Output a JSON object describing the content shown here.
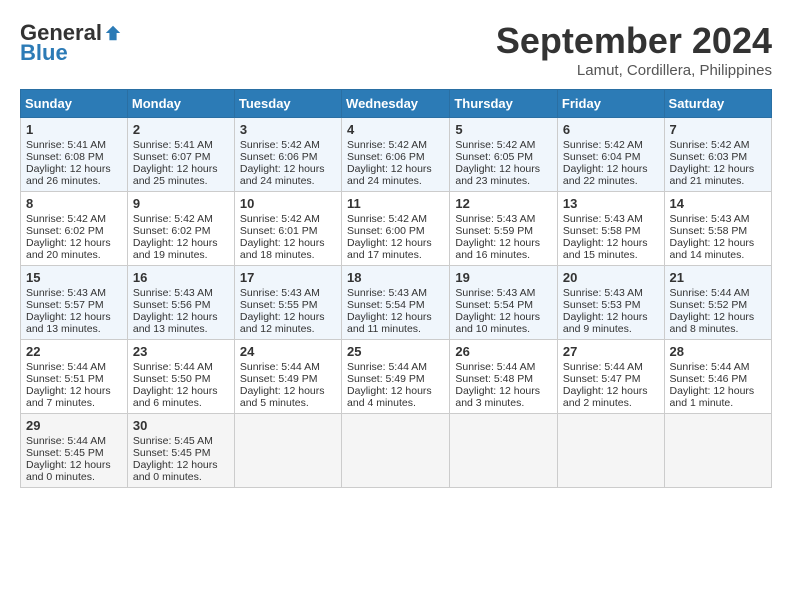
{
  "header": {
    "logo_general": "General",
    "logo_blue": "Blue",
    "month_title": "September 2024",
    "location": "Lamut, Cordillera, Philippines"
  },
  "calendar": {
    "days_of_week": [
      "Sunday",
      "Monday",
      "Tuesday",
      "Wednesday",
      "Thursday",
      "Friday",
      "Saturday"
    ],
    "weeks": [
      [
        {
          "day": "1",
          "sunrise": "Sunrise: 5:41 AM",
          "sunset": "Sunset: 6:08 PM",
          "daylight": "Daylight: 12 hours and 26 minutes."
        },
        {
          "day": "2",
          "sunrise": "Sunrise: 5:41 AM",
          "sunset": "Sunset: 6:07 PM",
          "daylight": "Daylight: 12 hours and 25 minutes."
        },
        {
          "day": "3",
          "sunrise": "Sunrise: 5:42 AM",
          "sunset": "Sunset: 6:06 PM",
          "daylight": "Daylight: 12 hours and 24 minutes."
        },
        {
          "day": "4",
          "sunrise": "Sunrise: 5:42 AM",
          "sunset": "Sunset: 6:06 PM",
          "daylight": "Daylight: 12 hours and 24 minutes."
        },
        {
          "day": "5",
          "sunrise": "Sunrise: 5:42 AM",
          "sunset": "Sunset: 6:05 PM",
          "daylight": "Daylight: 12 hours and 23 minutes."
        },
        {
          "day": "6",
          "sunrise": "Sunrise: 5:42 AM",
          "sunset": "Sunset: 6:04 PM",
          "daylight": "Daylight: 12 hours and 22 minutes."
        },
        {
          "day": "7",
          "sunrise": "Sunrise: 5:42 AM",
          "sunset": "Sunset: 6:03 PM",
          "daylight": "Daylight: 12 hours and 21 minutes."
        }
      ],
      [
        {
          "day": "8",
          "sunrise": "Sunrise: 5:42 AM",
          "sunset": "Sunset: 6:02 PM",
          "daylight": "Daylight: 12 hours and 20 minutes."
        },
        {
          "day": "9",
          "sunrise": "Sunrise: 5:42 AM",
          "sunset": "Sunset: 6:02 PM",
          "daylight": "Daylight: 12 hours and 19 minutes."
        },
        {
          "day": "10",
          "sunrise": "Sunrise: 5:42 AM",
          "sunset": "Sunset: 6:01 PM",
          "daylight": "Daylight: 12 hours and 18 minutes."
        },
        {
          "day": "11",
          "sunrise": "Sunrise: 5:42 AM",
          "sunset": "Sunset: 6:00 PM",
          "daylight": "Daylight: 12 hours and 17 minutes."
        },
        {
          "day": "12",
          "sunrise": "Sunrise: 5:43 AM",
          "sunset": "Sunset: 5:59 PM",
          "daylight": "Daylight: 12 hours and 16 minutes."
        },
        {
          "day": "13",
          "sunrise": "Sunrise: 5:43 AM",
          "sunset": "Sunset: 5:58 PM",
          "daylight": "Daylight: 12 hours and 15 minutes."
        },
        {
          "day": "14",
          "sunrise": "Sunrise: 5:43 AM",
          "sunset": "Sunset: 5:58 PM",
          "daylight": "Daylight: 12 hours and 14 minutes."
        }
      ],
      [
        {
          "day": "15",
          "sunrise": "Sunrise: 5:43 AM",
          "sunset": "Sunset: 5:57 PM",
          "daylight": "Daylight: 12 hours and 13 minutes."
        },
        {
          "day": "16",
          "sunrise": "Sunrise: 5:43 AM",
          "sunset": "Sunset: 5:56 PM",
          "daylight": "Daylight: 12 hours and 13 minutes."
        },
        {
          "day": "17",
          "sunrise": "Sunrise: 5:43 AM",
          "sunset": "Sunset: 5:55 PM",
          "daylight": "Daylight: 12 hours and 12 minutes."
        },
        {
          "day": "18",
          "sunrise": "Sunrise: 5:43 AM",
          "sunset": "Sunset: 5:54 PM",
          "daylight": "Daylight: 12 hours and 11 minutes."
        },
        {
          "day": "19",
          "sunrise": "Sunrise: 5:43 AM",
          "sunset": "Sunset: 5:54 PM",
          "daylight": "Daylight: 12 hours and 10 minutes."
        },
        {
          "day": "20",
          "sunrise": "Sunrise: 5:43 AM",
          "sunset": "Sunset: 5:53 PM",
          "daylight": "Daylight: 12 hours and 9 minutes."
        },
        {
          "day": "21",
          "sunrise": "Sunrise: 5:44 AM",
          "sunset": "Sunset: 5:52 PM",
          "daylight": "Daylight: 12 hours and 8 minutes."
        }
      ],
      [
        {
          "day": "22",
          "sunrise": "Sunrise: 5:44 AM",
          "sunset": "Sunset: 5:51 PM",
          "daylight": "Daylight: 12 hours and 7 minutes."
        },
        {
          "day": "23",
          "sunrise": "Sunrise: 5:44 AM",
          "sunset": "Sunset: 5:50 PM",
          "daylight": "Daylight: 12 hours and 6 minutes."
        },
        {
          "day": "24",
          "sunrise": "Sunrise: 5:44 AM",
          "sunset": "Sunset: 5:49 PM",
          "daylight": "Daylight: 12 hours and 5 minutes."
        },
        {
          "day": "25",
          "sunrise": "Sunrise: 5:44 AM",
          "sunset": "Sunset: 5:49 PM",
          "daylight": "Daylight: 12 hours and 4 minutes."
        },
        {
          "day": "26",
          "sunrise": "Sunrise: 5:44 AM",
          "sunset": "Sunset: 5:48 PM",
          "daylight": "Daylight: 12 hours and 3 minutes."
        },
        {
          "day": "27",
          "sunrise": "Sunrise: 5:44 AM",
          "sunset": "Sunset: 5:47 PM",
          "daylight": "Daylight: 12 hours and 2 minutes."
        },
        {
          "day": "28",
          "sunrise": "Sunrise: 5:44 AM",
          "sunset": "Sunset: 5:46 PM",
          "daylight": "Daylight: 12 hours and 1 minute."
        }
      ],
      [
        {
          "day": "29",
          "sunrise": "Sunrise: 5:44 AM",
          "sunset": "Sunset: 5:45 PM",
          "daylight": "Daylight: 12 hours and 0 minutes."
        },
        {
          "day": "30",
          "sunrise": "Sunrise: 5:45 AM",
          "sunset": "Sunset: 5:45 PM",
          "daylight": "Daylight: 12 hours and 0 minutes."
        },
        {
          "day": "",
          "sunrise": "",
          "sunset": "",
          "daylight": ""
        },
        {
          "day": "",
          "sunrise": "",
          "sunset": "",
          "daylight": ""
        },
        {
          "day": "",
          "sunrise": "",
          "sunset": "",
          "daylight": ""
        },
        {
          "day": "",
          "sunrise": "",
          "sunset": "",
          "daylight": ""
        },
        {
          "day": "",
          "sunrise": "",
          "sunset": "",
          "daylight": ""
        }
      ]
    ]
  }
}
